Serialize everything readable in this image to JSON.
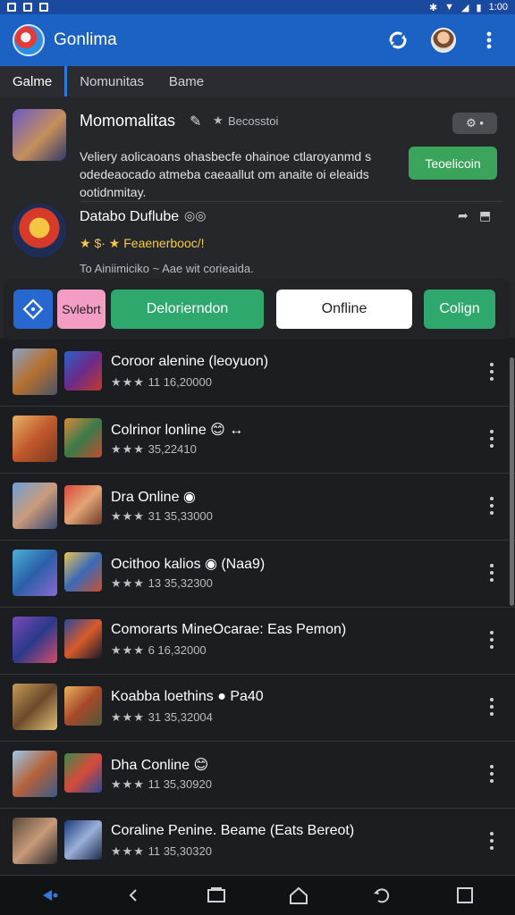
{
  "status_bar": {
    "time": "1:00"
  },
  "app_bar": {
    "title": "Gonlima"
  },
  "tabs": [
    {
      "label": "Galme",
      "active": true
    },
    {
      "label": "Nomunitas",
      "active": false
    },
    {
      "label": "Bame",
      "active": false
    }
  ],
  "featured": [
    {
      "title": "Momomalitas",
      "meta": "Becosstoi",
      "desc": "Veliery aolicaoans ohasbecfe ohainoe ctlaroyanmd s odedeaocado atmeba caeaallut om anaite oi eleaids ootidnmitay.",
      "side_pill": "⚙ •",
      "action_label": "Teoelicoin"
    },
    {
      "title": "Databo Duflube",
      "rating": "★ $· ★",
      "promo": "Feaenerbooc/!",
      "subtitle": "To Ainiimiciko ~ Aae wit corieaida."
    }
  ],
  "chips": [
    {
      "label": "Svlebrt"
    },
    {
      "label": "Delorierndon"
    },
    {
      "label": "Onfline"
    },
    {
      "label": "Colign"
    }
  ],
  "games": [
    {
      "title": "Coroor alenine (leoyuon)",
      "rating_text": "11 16,20000"
    },
    {
      "title": "Colrinor lonline 😊 ↔",
      "rating_text": "35,22410"
    },
    {
      "title": "Dra Online ◉",
      "rating_text": "31 35,33000"
    },
    {
      "title": "Ocithoo kalios ◉ (Naa9)",
      "rating_text": "13 35,32300"
    },
    {
      "title": "Comorarts MineOcarae: Eas Pemon)",
      "rating_text": "6 16,32000"
    },
    {
      "title": "Koabba loethins ● Pa40",
      "rating_text": "31 35,32004"
    },
    {
      "title": "Dha Conline 😊",
      "rating_text": "11 35,30920"
    },
    {
      "title": "Coraline Penine. Beame (Eats Bereot)",
      "rating_text": "11 35,30320"
    }
  ],
  "colors": {
    "app_bar": "#1b62c4",
    "accent_green": "#2ea86c",
    "background": "#1c1d20"
  }
}
